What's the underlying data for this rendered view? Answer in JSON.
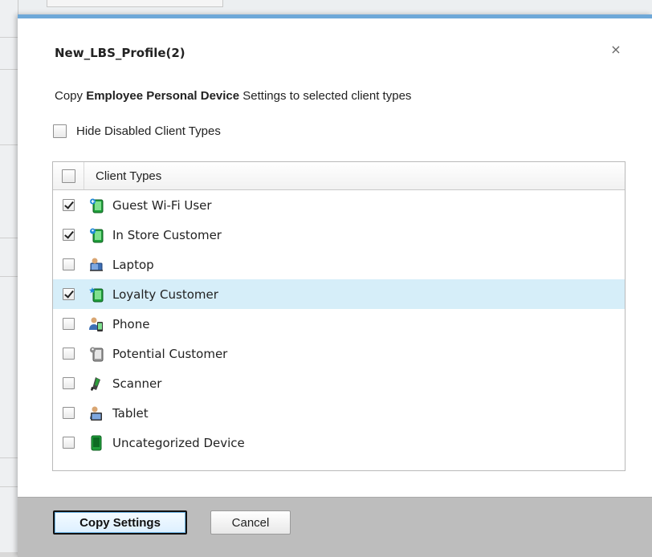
{
  "dialog": {
    "title": "New_LBS_Profile(2)",
    "close_glyph": "×",
    "subtitle_prefix": "Copy ",
    "subtitle_bold": "Employee Personal Device",
    "subtitle_suffix": " Settings to selected client types",
    "hide_disabled_label": "Hide Disabled Client Types",
    "hide_disabled_checked": false
  },
  "table": {
    "header": "Client Types",
    "select_all_checked": false,
    "rows": [
      {
        "label": "Guest Wi-Fi User",
        "checked": true,
        "icon": "guest-device-icon"
      },
      {
        "label": "In Store Customer",
        "checked": true,
        "icon": "customer-device-icon"
      },
      {
        "label": "Laptop",
        "checked": false,
        "icon": "laptop-user-icon"
      },
      {
        "label": "Loyalty Customer",
        "checked": true,
        "icon": "loyalty-device-icon",
        "selected": true
      },
      {
        "label": "Phone",
        "checked": false,
        "icon": "phone-user-icon"
      },
      {
        "label": "Potential Customer",
        "checked": false,
        "icon": "potential-device-icon"
      },
      {
        "label": "Scanner",
        "checked": false,
        "icon": "scanner-icon"
      },
      {
        "label": "Tablet",
        "checked": false,
        "icon": "tablet-user-icon"
      },
      {
        "label": "Uncategorized Device",
        "checked": false,
        "icon": "uncategorized-device-icon"
      }
    ]
  },
  "footer": {
    "copy_label": "Copy Settings",
    "cancel_label": "Cancel"
  },
  "colors": {
    "accent": "#6ea8d8",
    "selected_row": "#d6eef9",
    "footer_bg": "#bdbdbd"
  }
}
